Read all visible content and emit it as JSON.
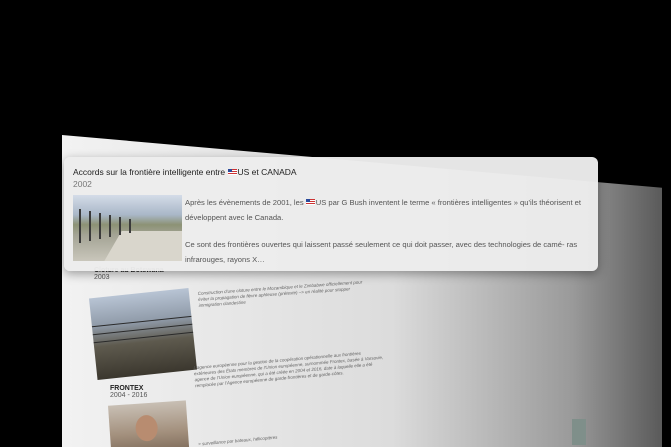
{
  "card": {
    "title_prefix": "Accords sur la frontière intelligente entre",
    "title_suffix": "US et CANADA",
    "year": "2002",
    "flag_icon": "us-flag-icon",
    "p1_prefix": "Après les évènements de 2001, les",
    "p1_suffix": "US par G Bush inventent le terme « frontières intelligentes » qu'ils théorisent et développent avec le Canada.",
    "p2": "Ce sont des frontières ouvertes qui laissent passé seulement ce qui doit passer, avec des technologies de camé- ras infrarouges, rayons X…"
  },
  "background": {
    "entry1": {
      "title": "Cloture au Botswana",
      "year": "2003",
      "text": "Construction d'une cloture entre le Mozambique et le Zimbabwe officiellement pour éviter la propagation de fièvre aphteuse (prétexte) –> en réalité pour stopper immigration clandestine"
    },
    "entry2": {
      "title": "FRONTEX",
      "year": "2004 - 2016",
      "text": "L'agence européenne pour la gestion de la coopération opérationnelle aux frontières extérieures des États membres de l'Union européenne, surnommée Frontex, basée à Varsovie, agence de l'Union européenne, qui a été créée en 2004 et 2016, date à laquelle elle a été remplacée par l'Agence européenne de garde-frontières et de garde-côtes.",
      "note": "> surveillance par bateaux, hélicoptères"
    }
  }
}
